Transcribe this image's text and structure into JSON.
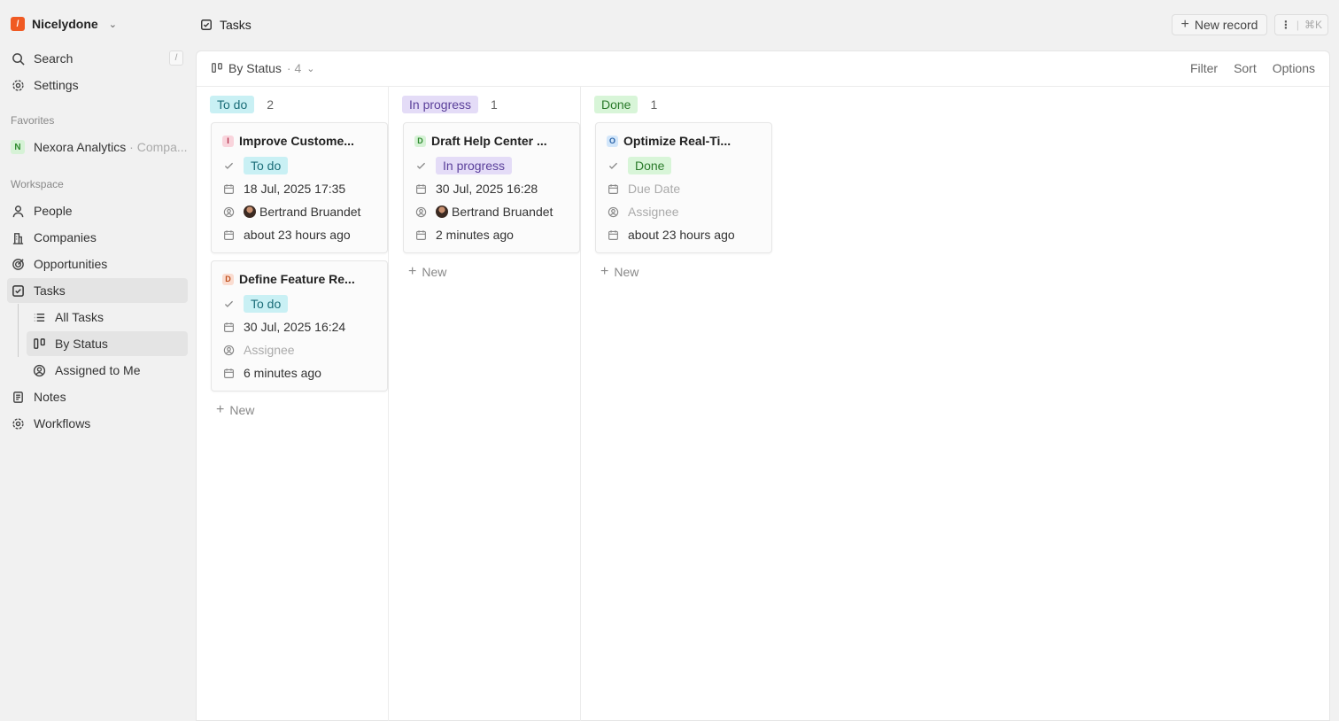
{
  "workspace": {
    "name": "Nicelydone",
    "logo_letter": "/"
  },
  "sidebar": {
    "search_label": "Search",
    "search_shortcut": "/",
    "settings_label": "Settings",
    "favorites_label": "Favorites",
    "favorite": {
      "letter": "N",
      "name": "Nexora Analytics",
      "sub": "· Compa..."
    },
    "workspace_label": "Workspace",
    "items": [
      {
        "label": "People"
      },
      {
        "label": "Companies"
      },
      {
        "label": "Opportunities"
      },
      {
        "label": "Tasks"
      },
      {
        "label": "All Tasks"
      },
      {
        "label": "By Status"
      },
      {
        "label": "Assigned to Me"
      },
      {
        "label": "Notes"
      },
      {
        "label": "Workflows"
      }
    ]
  },
  "header": {
    "title": "Tasks",
    "new_record_label": "New record",
    "shortcut": "⌘K"
  },
  "view": {
    "name": "By Status",
    "count": "· 4",
    "filter": "Filter",
    "sort": "Sort",
    "options": "Options"
  },
  "colors": {
    "todo_bg": "#c9f0f4",
    "todo_fg": "#1b6d78",
    "progress_bg": "#e4dcf7",
    "progress_fg": "#5a3f9a",
    "done_bg": "#d8f5d8",
    "done_fg": "#2a7a2a"
  },
  "columns": [
    {
      "label": "To do",
      "count": "2",
      "new_label": "New",
      "cards": [
        {
          "letter": "I",
          "title": "Improve Custome...",
          "status": "To do",
          "due": "18 Jul, 2025 17:35",
          "assignee": "Bertrand Bruandet",
          "created": "about 23 hours ago"
        },
        {
          "letter": "D",
          "title": "Define Feature Re...",
          "status": "To do",
          "due": "30 Jul, 2025 16:24",
          "assignee": "Assignee",
          "created": "6 minutes ago"
        }
      ]
    },
    {
      "label": "In progress",
      "count": "1",
      "new_label": "New",
      "cards": [
        {
          "letter": "D",
          "title": "Draft Help Center ...",
          "status": "In progress",
          "due": "30 Jul, 2025 16:28",
          "assignee": "Bertrand Bruandet",
          "created": "2 minutes ago"
        }
      ]
    },
    {
      "label": "Done",
      "count": "1",
      "new_label": "New",
      "cards": [
        {
          "letter": "O",
          "title": "Optimize Real-Ti...",
          "status": "Done",
          "due": "Due Date",
          "assignee": "Assignee",
          "created": "about 23 hours ago"
        }
      ]
    }
  ]
}
